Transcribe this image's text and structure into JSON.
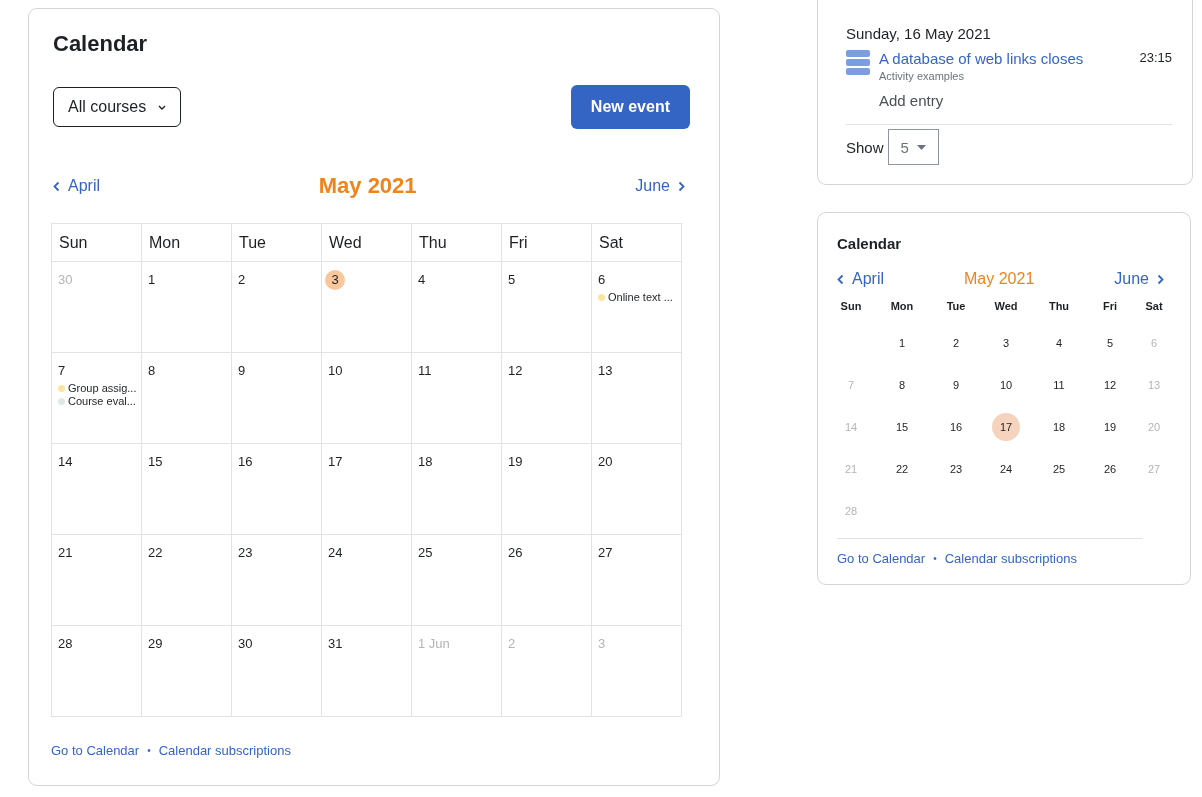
{
  "main_calendar": {
    "title": "Calendar",
    "course_filter": "All courses",
    "new_event_button": "New event",
    "prev_month": "April",
    "month": "May 2021",
    "next_month": "June",
    "weekdays": [
      "Sun",
      "Mon",
      "Tue",
      "Wed",
      "Thu",
      "Fri",
      "Sat"
    ],
    "weeks": [
      [
        {
          "label": "30",
          "muted": true,
          "today": false
        },
        {
          "label": "1",
          "muted": false,
          "today": false
        },
        {
          "label": "2",
          "muted": false,
          "today": false
        },
        {
          "label": "3",
          "muted": false,
          "today": true
        },
        {
          "label": "4",
          "muted": false,
          "today": false
        },
        {
          "label": "5",
          "muted": false,
          "today": false
        },
        {
          "label": "6",
          "muted": false,
          "today": false,
          "events": [
            {
              "title": "Online text ...",
              "color": "#f9e6a0"
            }
          ]
        }
      ],
      [
        {
          "label": "7",
          "muted": false,
          "today": false,
          "events": [
            {
              "title": "Group assig...",
              "color": "#f9e6a0"
            },
            {
              "title": "Course eval...",
              "color": "#e1e6ea"
            }
          ]
        },
        {
          "label": "8",
          "muted": false,
          "today": false
        },
        {
          "label": "9",
          "muted": false,
          "today": false
        },
        {
          "label": "10",
          "muted": false,
          "today": false
        },
        {
          "label": "11",
          "muted": false,
          "today": false
        },
        {
          "label": "12",
          "muted": false,
          "today": false
        },
        {
          "label": "13",
          "muted": false,
          "today": false
        }
      ],
      [
        {
          "label": "14",
          "muted": false,
          "today": false
        },
        {
          "label": "15",
          "muted": false,
          "today": false
        },
        {
          "label": "16",
          "muted": false,
          "today": false
        },
        {
          "label": "17",
          "muted": false,
          "today": false
        },
        {
          "label": "18",
          "muted": false,
          "today": false
        },
        {
          "label": "19",
          "muted": false,
          "today": false
        },
        {
          "label": "20",
          "muted": false,
          "today": false
        }
      ],
      [
        {
          "label": "21",
          "muted": false,
          "today": false
        },
        {
          "label": "22",
          "muted": false,
          "today": false
        },
        {
          "label": "23",
          "muted": false,
          "today": false
        },
        {
          "label": "24",
          "muted": false,
          "today": false
        },
        {
          "label": "25",
          "muted": false,
          "today": false
        },
        {
          "label": "26",
          "muted": false,
          "today": false
        },
        {
          "label": "27",
          "muted": false,
          "today": false
        }
      ],
      [
        {
          "label": "28",
          "muted": false,
          "today": false
        },
        {
          "label": "29",
          "muted": false,
          "today": false
        },
        {
          "label": "30",
          "muted": false,
          "today": false
        },
        {
          "label": "31",
          "muted": false,
          "today": false
        },
        {
          "label": "1 Jun",
          "muted": true,
          "today": false
        },
        {
          "label": "2",
          "muted": true,
          "today": false
        },
        {
          "label": "3",
          "muted": true,
          "today": false
        }
      ]
    ],
    "footer_links": [
      "Go to Calendar",
      "Calendar subscriptions"
    ],
    "separator": "•"
  },
  "upcoming": {
    "date": "Sunday, 16 May 2021",
    "event_title": "A database of web links closes",
    "event_course": "Activity examples",
    "time": "23:15",
    "action": "Add entry",
    "show_label": "Show",
    "show_value": "5"
  },
  "mini_calendar": {
    "title": "Calendar",
    "prev_month": "April",
    "month": "May 2021",
    "next_month": "June",
    "weekdays": [
      "Sun",
      "Mon",
      "Tue",
      "Wed",
      "Thu",
      "Fri",
      "Sat"
    ],
    "weeks": [
      {
        "kind": "partial_start",
        "days": [
          {
            "label": "1",
            "muted": false,
            "today": false
          },
          {
            "label": "2",
            "muted": false,
            "today": false
          },
          {
            "label": "3",
            "muted": false,
            "today": false
          },
          {
            "label": "4",
            "muted": false,
            "today": false
          },
          {
            "label": "5",
            "muted": false,
            "today": false
          },
          {
            "label": "6",
            "muted": true,
            "today": false
          }
        ]
      },
      {
        "kind": "full",
        "days": [
          {
            "label": "7",
            "muted": true,
            "today": false
          },
          {
            "label": "8",
            "muted": false,
            "today": false
          },
          {
            "label": "9",
            "muted": false,
            "today": false
          },
          {
            "label": "10",
            "muted": false,
            "today": false
          },
          {
            "label": "11",
            "muted": false,
            "today": false
          },
          {
            "label": "12",
            "muted": false,
            "today": false
          },
          {
            "label": "13",
            "muted": true,
            "today": false
          }
        ]
      },
      {
        "kind": "full",
        "days": [
          {
            "label": "14",
            "muted": true,
            "today": false
          },
          {
            "label": "15",
            "muted": false,
            "today": false
          },
          {
            "label": "16",
            "muted": false,
            "today": false
          },
          {
            "label": "17",
            "muted": false,
            "today": true
          },
          {
            "label": "18",
            "muted": false,
            "today": false
          },
          {
            "label": "19",
            "muted": false,
            "today": false
          },
          {
            "label": "20",
            "muted": true,
            "today": false
          }
        ]
      },
      {
        "kind": "full",
        "days": [
          {
            "label": "21",
            "muted": true,
            "today": false
          },
          {
            "label": "22",
            "muted": false,
            "today": false
          },
          {
            "label": "23",
            "muted": false,
            "today": false
          },
          {
            "label": "24",
            "muted": false,
            "today": false
          },
          {
            "label": "25",
            "muted": false,
            "today": false
          },
          {
            "label": "26",
            "muted": false,
            "today": false
          },
          {
            "label": "27",
            "muted": true,
            "today": false
          }
        ]
      },
      {
        "kind": "partial_end",
        "days": [
          {
            "label": "28",
            "muted": true,
            "today": false
          }
        ]
      }
    ],
    "footer_links": [
      "Go to Calendar",
      "Calendar subscriptions"
    ],
    "separator": "•"
  }
}
